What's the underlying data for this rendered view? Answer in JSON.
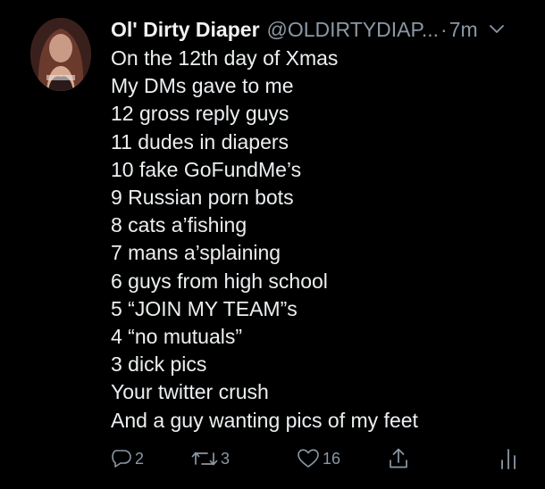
{
  "tweet": {
    "display_name": "Ol' Dirty Diaper",
    "handle": "@OLDIRTYDIAP...",
    "separator": "·",
    "time": "7m",
    "lines": [
      "On the 12th day of Xmas",
      "My DMs gave to me",
      "12 gross reply guys",
      "11 dudes in diapers",
      "10 fake GoFundMe’s",
      "9 Russian porn bots",
      "8 cats a’fishing",
      "7 mans a’splaining",
      "6 guys from high school",
      "5 “JOIN MY TEAM”s",
      "4 “no mutuals”",
      "3 dick pics",
      "Your twitter crush",
      "And a guy wanting pics of my feet"
    ]
  },
  "actions": {
    "reply_count": "2",
    "retweet_count": "3",
    "like_count": "16"
  },
  "icons": {
    "reply": "reply-icon",
    "retweet": "retweet-icon",
    "like": "heart-icon",
    "share": "share-icon",
    "analytics": "analytics-icon",
    "caret": "chevron-down-icon"
  },
  "colors": {
    "background": "#000000",
    "text": "#eceff1",
    "muted": "#8b98a5"
  }
}
